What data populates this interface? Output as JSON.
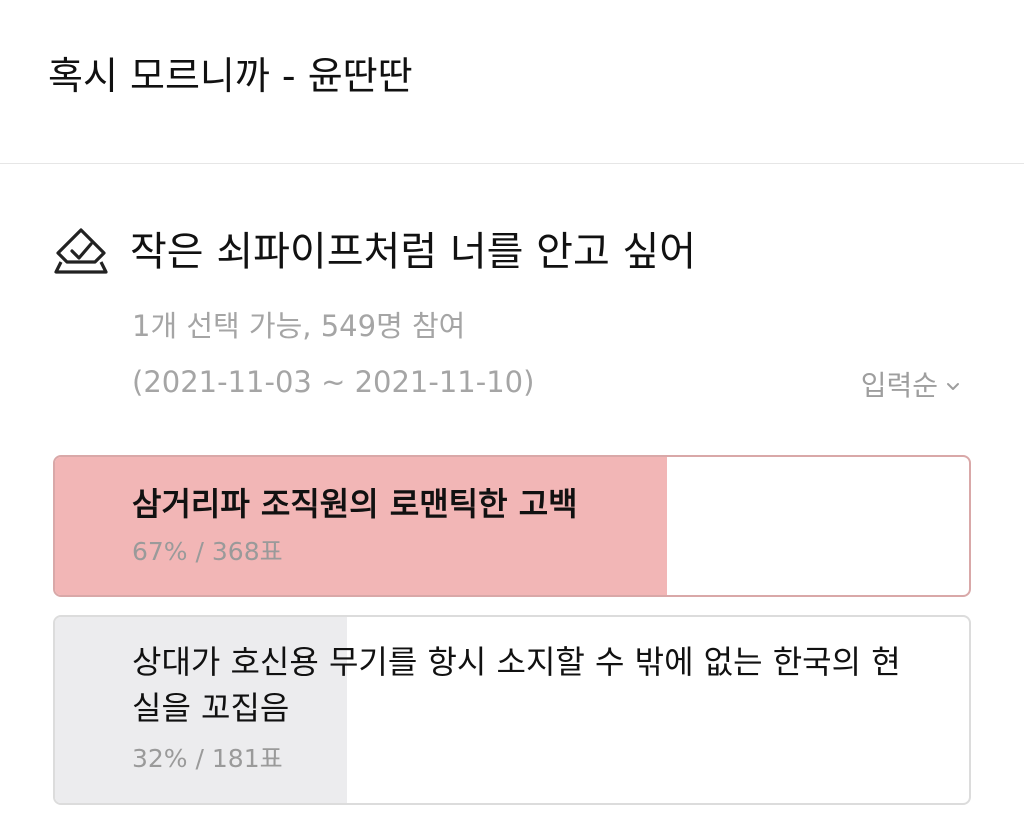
{
  "header": {
    "title": "혹시 모르니까 - 윤딴딴"
  },
  "poll": {
    "icon": "ballot-check-icon",
    "question": "작은 쇠파이프처럼 너를 안고 싶어",
    "meta": "1개 선택 가능, 549명 참여",
    "date_range": "(2021-11-03 ~ 2021-11-10)",
    "sort": {
      "label": "입력순",
      "icon": "chevron-down-icon"
    },
    "options": [
      {
        "text": "삼거리파 조직원의 로맨틱한 고백",
        "stat": "67% / 368표",
        "percent": 67,
        "votes": 368,
        "selected": true,
        "fill_color": "#f2b6b6"
      },
      {
        "text": "상대가 호신용 무기를 항시 소지할 수 밖에 없는 한국의 현실을 꼬집음",
        "stat": "32% / 181표",
        "percent": 32,
        "votes": 181,
        "selected": false,
        "fill_color": "#ececee"
      }
    ]
  }
}
